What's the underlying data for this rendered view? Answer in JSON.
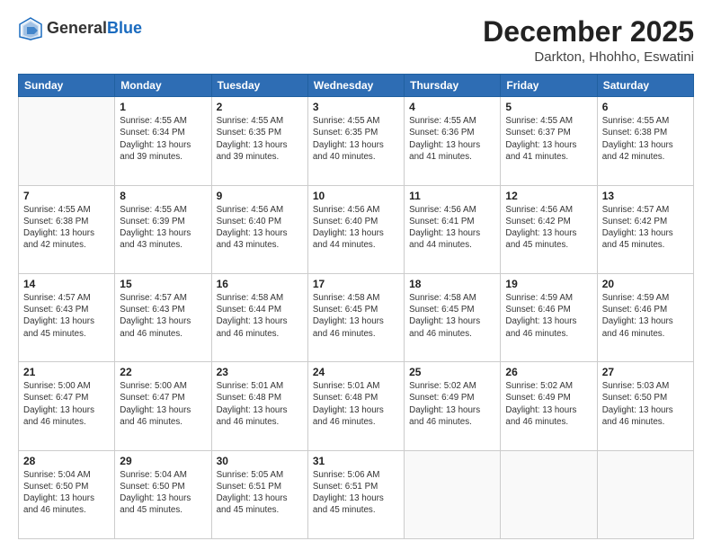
{
  "header": {
    "logo_general": "General",
    "logo_blue": "Blue",
    "month": "December 2025",
    "location": "Darkton, Hhohho, Eswatini"
  },
  "days_of_week": [
    "Sunday",
    "Monday",
    "Tuesday",
    "Wednesday",
    "Thursday",
    "Friday",
    "Saturday"
  ],
  "weeks": [
    [
      {
        "day": "",
        "info": ""
      },
      {
        "day": "1",
        "info": "Sunrise: 4:55 AM\nSunset: 6:34 PM\nDaylight: 13 hours\nand 39 minutes."
      },
      {
        "day": "2",
        "info": "Sunrise: 4:55 AM\nSunset: 6:35 PM\nDaylight: 13 hours\nand 39 minutes."
      },
      {
        "day": "3",
        "info": "Sunrise: 4:55 AM\nSunset: 6:35 PM\nDaylight: 13 hours\nand 40 minutes."
      },
      {
        "day": "4",
        "info": "Sunrise: 4:55 AM\nSunset: 6:36 PM\nDaylight: 13 hours\nand 41 minutes."
      },
      {
        "day": "5",
        "info": "Sunrise: 4:55 AM\nSunset: 6:37 PM\nDaylight: 13 hours\nand 41 minutes."
      },
      {
        "day": "6",
        "info": "Sunrise: 4:55 AM\nSunset: 6:38 PM\nDaylight: 13 hours\nand 42 minutes."
      }
    ],
    [
      {
        "day": "7",
        "info": "Sunrise: 4:55 AM\nSunset: 6:38 PM\nDaylight: 13 hours\nand 42 minutes."
      },
      {
        "day": "8",
        "info": "Sunrise: 4:55 AM\nSunset: 6:39 PM\nDaylight: 13 hours\nand 43 minutes."
      },
      {
        "day": "9",
        "info": "Sunrise: 4:56 AM\nSunset: 6:40 PM\nDaylight: 13 hours\nand 43 minutes."
      },
      {
        "day": "10",
        "info": "Sunrise: 4:56 AM\nSunset: 6:40 PM\nDaylight: 13 hours\nand 44 minutes."
      },
      {
        "day": "11",
        "info": "Sunrise: 4:56 AM\nSunset: 6:41 PM\nDaylight: 13 hours\nand 44 minutes."
      },
      {
        "day": "12",
        "info": "Sunrise: 4:56 AM\nSunset: 6:42 PM\nDaylight: 13 hours\nand 45 minutes."
      },
      {
        "day": "13",
        "info": "Sunrise: 4:57 AM\nSunset: 6:42 PM\nDaylight: 13 hours\nand 45 minutes."
      }
    ],
    [
      {
        "day": "14",
        "info": "Sunrise: 4:57 AM\nSunset: 6:43 PM\nDaylight: 13 hours\nand 45 minutes."
      },
      {
        "day": "15",
        "info": "Sunrise: 4:57 AM\nSunset: 6:43 PM\nDaylight: 13 hours\nand 46 minutes."
      },
      {
        "day": "16",
        "info": "Sunrise: 4:58 AM\nSunset: 6:44 PM\nDaylight: 13 hours\nand 46 minutes."
      },
      {
        "day": "17",
        "info": "Sunrise: 4:58 AM\nSunset: 6:45 PM\nDaylight: 13 hours\nand 46 minutes."
      },
      {
        "day": "18",
        "info": "Sunrise: 4:58 AM\nSunset: 6:45 PM\nDaylight: 13 hours\nand 46 minutes."
      },
      {
        "day": "19",
        "info": "Sunrise: 4:59 AM\nSunset: 6:46 PM\nDaylight: 13 hours\nand 46 minutes."
      },
      {
        "day": "20",
        "info": "Sunrise: 4:59 AM\nSunset: 6:46 PM\nDaylight: 13 hours\nand 46 minutes."
      }
    ],
    [
      {
        "day": "21",
        "info": "Sunrise: 5:00 AM\nSunset: 6:47 PM\nDaylight: 13 hours\nand 46 minutes."
      },
      {
        "day": "22",
        "info": "Sunrise: 5:00 AM\nSunset: 6:47 PM\nDaylight: 13 hours\nand 46 minutes."
      },
      {
        "day": "23",
        "info": "Sunrise: 5:01 AM\nSunset: 6:48 PM\nDaylight: 13 hours\nand 46 minutes."
      },
      {
        "day": "24",
        "info": "Sunrise: 5:01 AM\nSunset: 6:48 PM\nDaylight: 13 hours\nand 46 minutes."
      },
      {
        "day": "25",
        "info": "Sunrise: 5:02 AM\nSunset: 6:49 PM\nDaylight: 13 hours\nand 46 minutes."
      },
      {
        "day": "26",
        "info": "Sunrise: 5:02 AM\nSunset: 6:49 PM\nDaylight: 13 hours\nand 46 minutes."
      },
      {
        "day": "27",
        "info": "Sunrise: 5:03 AM\nSunset: 6:50 PM\nDaylight: 13 hours\nand 46 minutes."
      }
    ],
    [
      {
        "day": "28",
        "info": "Sunrise: 5:04 AM\nSunset: 6:50 PM\nDaylight: 13 hours\nand 46 minutes."
      },
      {
        "day": "29",
        "info": "Sunrise: 5:04 AM\nSunset: 6:50 PM\nDaylight: 13 hours\nand 45 minutes."
      },
      {
        "day": "30",
        "info": "Sunrise: 5:05 AM\nSunset: 6:51 PM\nDaylight: 13 hours\nand 45 minutes."
      },
      {
        "day": "31",
        "info": "Sunrise: 5:06 AM\nSunset: 6:51 PM\nDaylight: 13 hours\nand 45 minutes."
      },
      {
        "day": "",
        "info": ""
      },
      {
        "day": "",
        "info": ""
      },
      {
        "day": "",
        "info": ""
      }
    ]
  ]
}
